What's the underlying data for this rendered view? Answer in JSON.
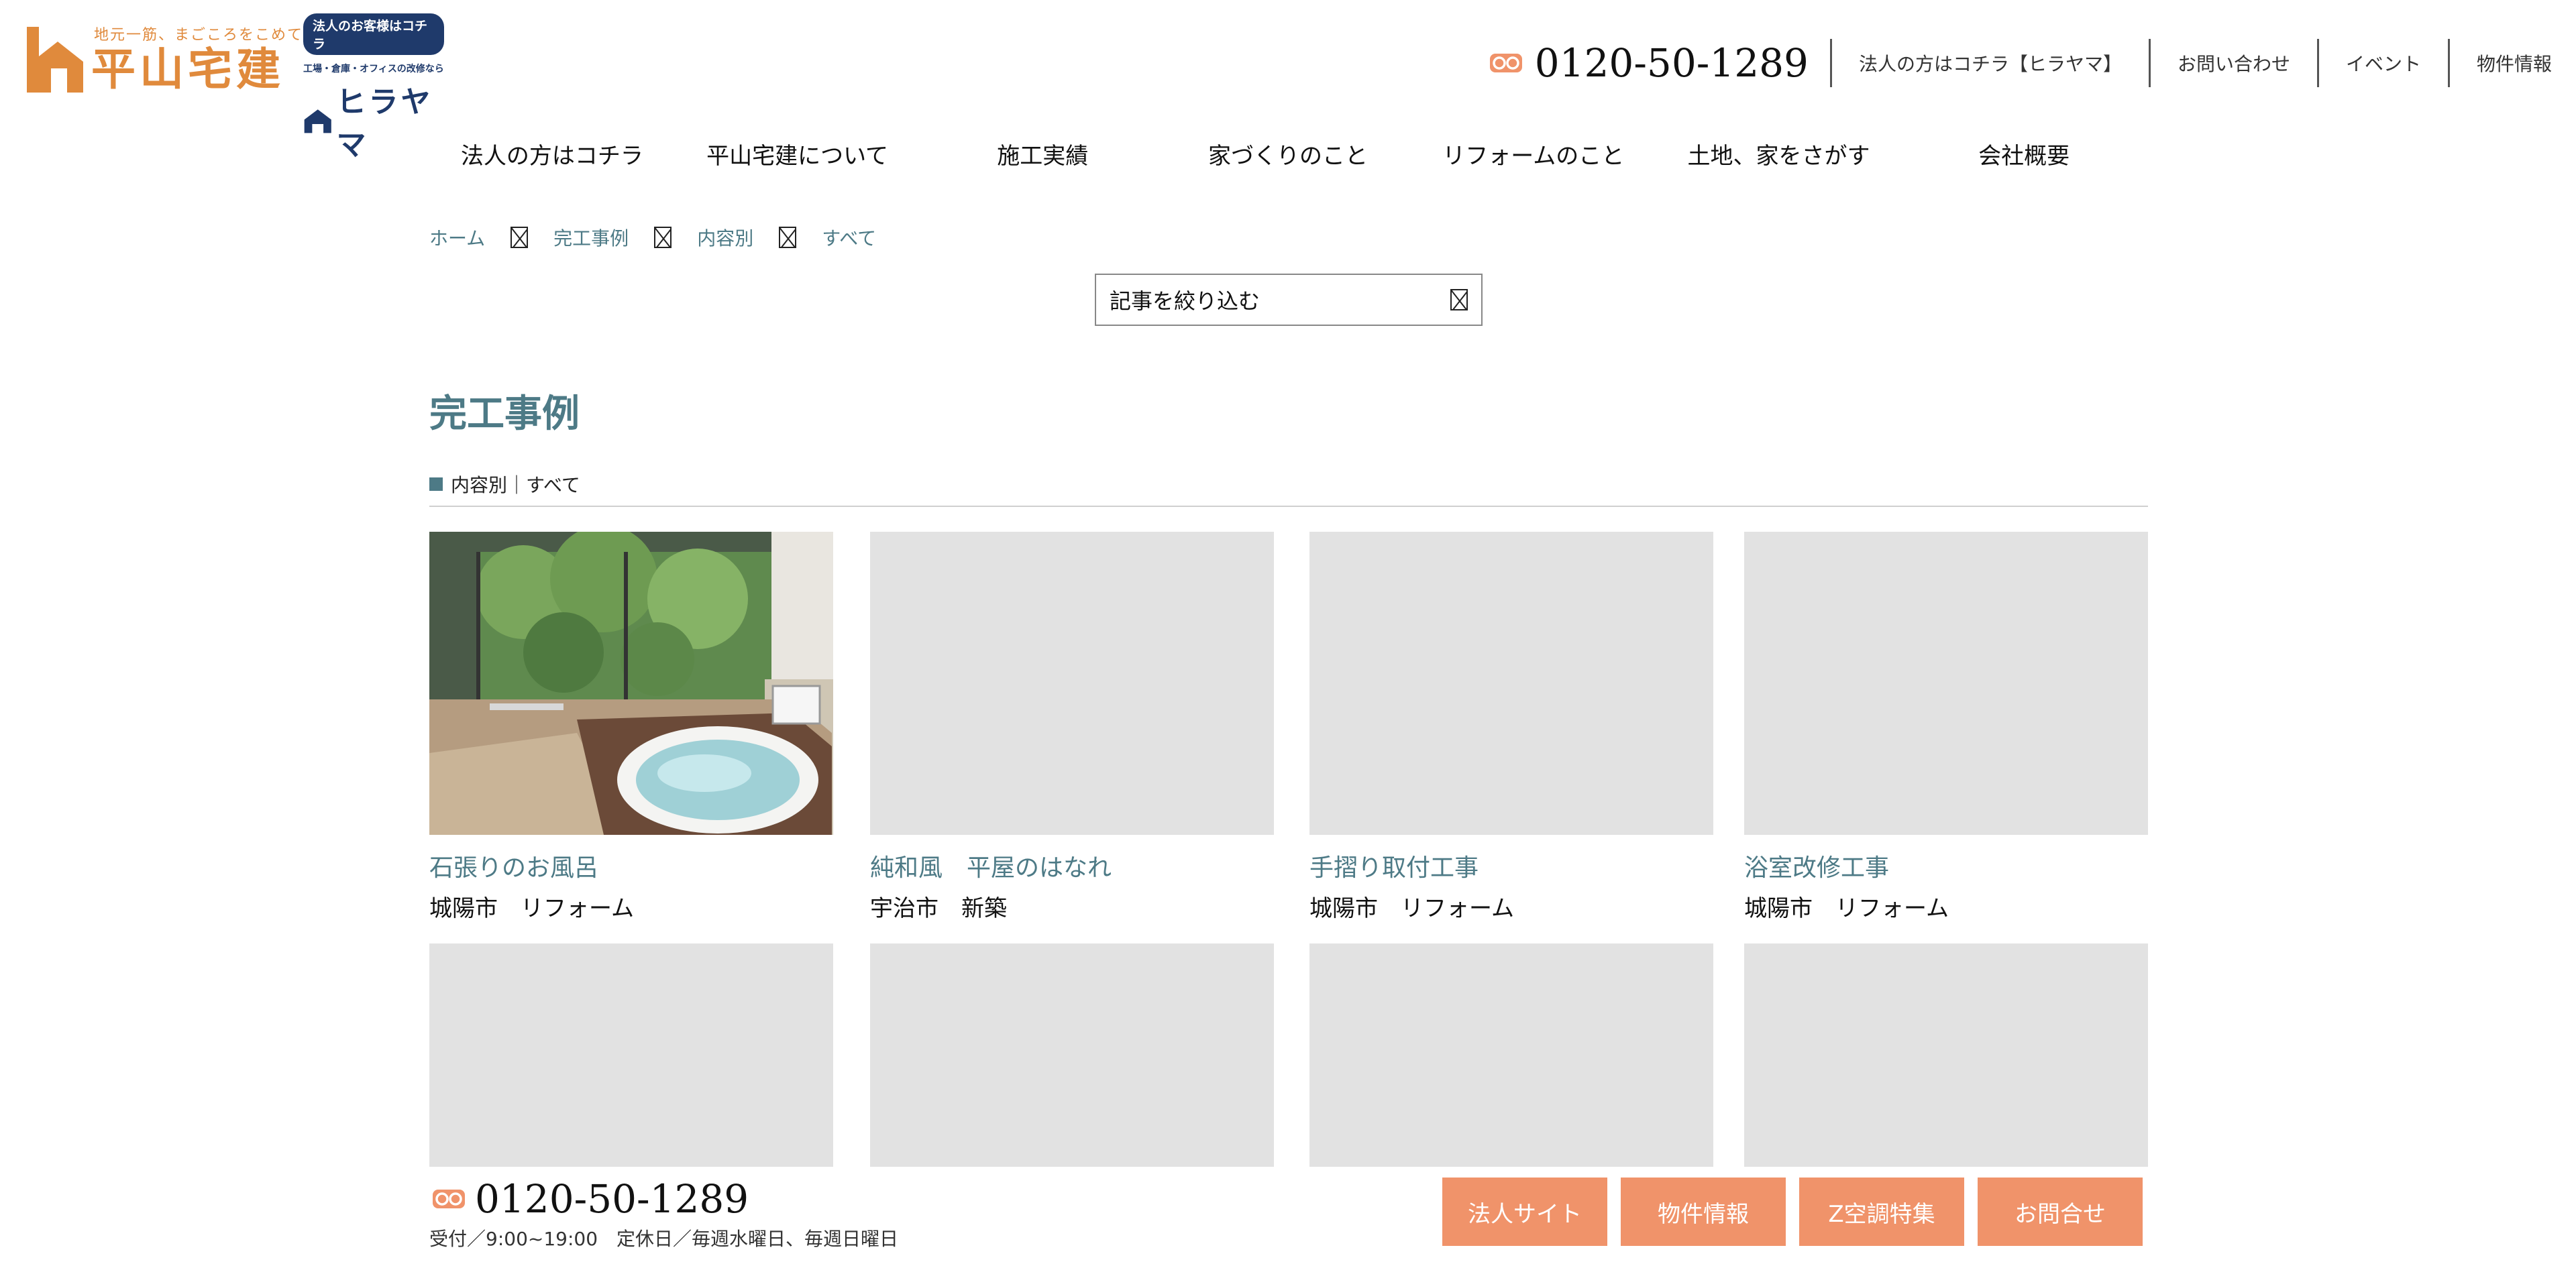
{
  "brand": {
    "tagline": "地元一筋、まごころをこめて",
    "name": "平山宅建",
    "corporate_badge": "法人のお客様はコチラ",
    "corporate_sub": "工場・倉庫・オフィスの改修なら",
    "corporate_name": "ヒラヤマ"
  },
  "header": {
    "phone": "0120-50-1289",
    "links": [
      "法人の方はコチラ【ヒラヤマ】",
      "お問い合わせ",
      "イベント",
      "物件情報"
    ]
  },
  "nav": {
    "items": [
      "法人の方はコチラ",
      "平山宅建について",
      "施工実績",
      "家づくりのこと",
      "リフォームのこと",
      "土地、家をさがす",
      "会社概要"
    ]
  },
  "breadcrumb": [
    "ホーム",
    "完工事例",
    "内容別",
    "すべて"
  ],
  "filter": {
    "label": "記事を絞り込む"
  },
  "page": {
    "title": "完工事例",
    "section": "内容別｜すべて"
  },
  "cards": [
    {
      "title": "石張りのお風呂",
      "meta": "城陽市　リフォーム",
      "has_photo": true
    },
    {
      "title": "純和風　平屋のはなれ",
      "meta": "宇治市　新築",
      "has_photo": false
    },
    {
      "title": "手摺り取付工事",
      "meta": "城陽市　リフォーム",
      "has_photo": false
    },
    {
      "title": "浴室改修工事",
      "meta": "城陽市　リフォーム",
      "has_photo": false
    },
    {
      "title": "",
      "meta": "",
      "has_photo": false
    },
    {
      "title": "",
      "meta": "",
      "has_photo": false
    },
    {
      "title": "",
      "meta": "",
      "has_photo": false
    },
    {
      "title": "",
      "meta": "",
      "has_photo": false
    }
  ],
  "footer_bar": {
    "phone": "0120-50-1289",
    "hours": "受付／9:00~19:00　定休日／毎週水曜日、毎週日曜日",
    "buttons": [
      "法人サイト",
      "物件情報",
      "Z空調特集",
      "お問合せ"
    ],
    "accent_color": "#f0936a"
  },
  "colors": {
    "brand_orange": "#e08a3c",
    "corporate_navy": "#1f3a6b",
    "link_teal": "#4d7a86",
    "placeholder_gray": "#e2e2e2"
  }
}
